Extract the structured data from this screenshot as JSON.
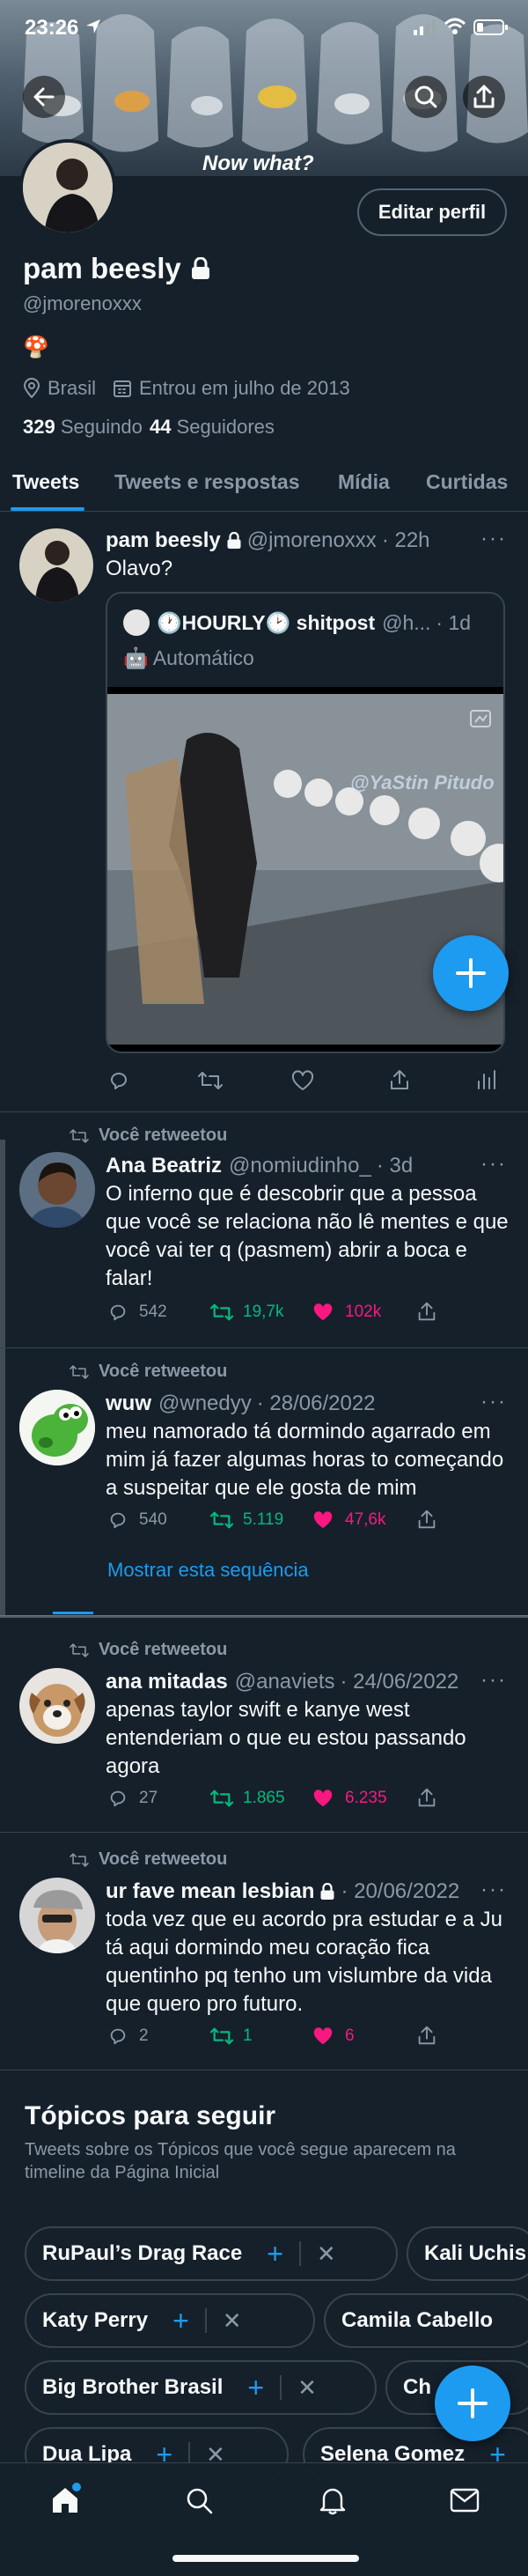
{
  "status_bar": {
    "time": "23:26"
  },
  "banner": {
    "caption": "Now what?"
  },
  "profile": {
    "edit_button": "Editar perfil",
    "name": "pam beesly",
    "handle": "@jmorenoxxx",
    "bio_emoji": "🍄",
    "location": "Brasil",
    "joined": "Entrou em julho de 2013",
    "following_count": "329",
    "following_label": "Seguindo",
    "followers_count": "44",
    "followers_label": "Seguidores"
  },
  "tabs": [
    {
      "label": "Tweets",
      "active": true
    },
    {
      "label": "Tweets e respostas"
    },
    {
      "label": "Mídia"
    },
    {
      "label": "Curtidas"
    }
  ],
  "pinned_tweet": {
    "name": "pam beesly",
    "handle": "@jmorenoxxx",
    "time": "· 22h",
    "text": "Olavo?",
    "quote": {
      "name": "🕐HOURLY🕑 shitpost",
      "handle": "@h...",
      "time": "· 1d",
      "subtext": "🤖 Automático",
      "watermark": "@YaStin Pitudo"
    }
  },
  "retweets": [
    {
      "rt_label": "Você retweetou",
      "name": "Ana Beatriz",
      "handle": "@nomiudinho_",
      "time": "· 3d",
      "lines": [
        "O inferno que é descobrir que a pessoa",
        "que você se relaciona não lê mentes e que",
        "você vai ter q (pasmem) abrir a boca e",
        "falar!"
      ],
      "replies": "542",
      "retweets": "19,7k",
      "likes": "102k"
    },
    {
      "rt_label": "Você retweetou",
      "name": "wuw",
      "handle": "@wnedyy",
      "time": "· 28/06/2022",
      "lines": [
        "meu namorado tá dormindo agarrado em",
        "mim já fazer algumas horas to começando",
        "a suspeitar que ele gosta de mim"
      ],
      "replies": "540",
      "retweets": "5.119",
      "likes": "47,6k",
      "show_thread": "Mostrar esta sequência"
    },
    {
      "rt_label": "Você retweetou",
      "name": "ana mitadas",
      "handle": "@anaviets",
      "time": "· 24/06/2022",
      "lines": [
        "apenas taylor swift e kanye west",
        "entenderiam o que eu estou passando",
        "agora"
      ],
      "replies": "27",
      "retweets": "1.865",
      "likes": "6.235"
    },
    {
      "rt_label": "Você retweetou",
      "name": "ur fave mean lesbian",
      "handle": "",
      "time": "· 20/06/2022",
      "lines": [
        "toda vez que eu acordo pra estudar e a Ju",
        "tá aqui dormindo meu coração fica",
        "quentinho pq tenho um vislumbre da vida",
        "que quero pro futuro."
      ],
      "replies": "2",
      "retweets": "1",
      "likes": "6"
    }
  ],
  "topics": {
    "title": "Tópicos para seguir",
    "subtitle_line1": "Tweets sobre os Tópicos que você segue aparecem na",
    "subtitle_line2": "timeline da Página Inicial",
    "chips": [
      "RuPaul’s Drag Race",
      "Kali Uchis",
      "Katy Perry",
      "Camila Cabello",
      "Big Brother Brasil",
      "Ch",
      "Dua Lipa",
      "Selena Gomez"
    ]
  },
  "colors": {
    "background": "#15202b",
    "accent": "#1d9bf0",
    "retweet": "#00ba7c",
    "like": "#f91880",
    "muted": "#8b98a5"
  }
}
